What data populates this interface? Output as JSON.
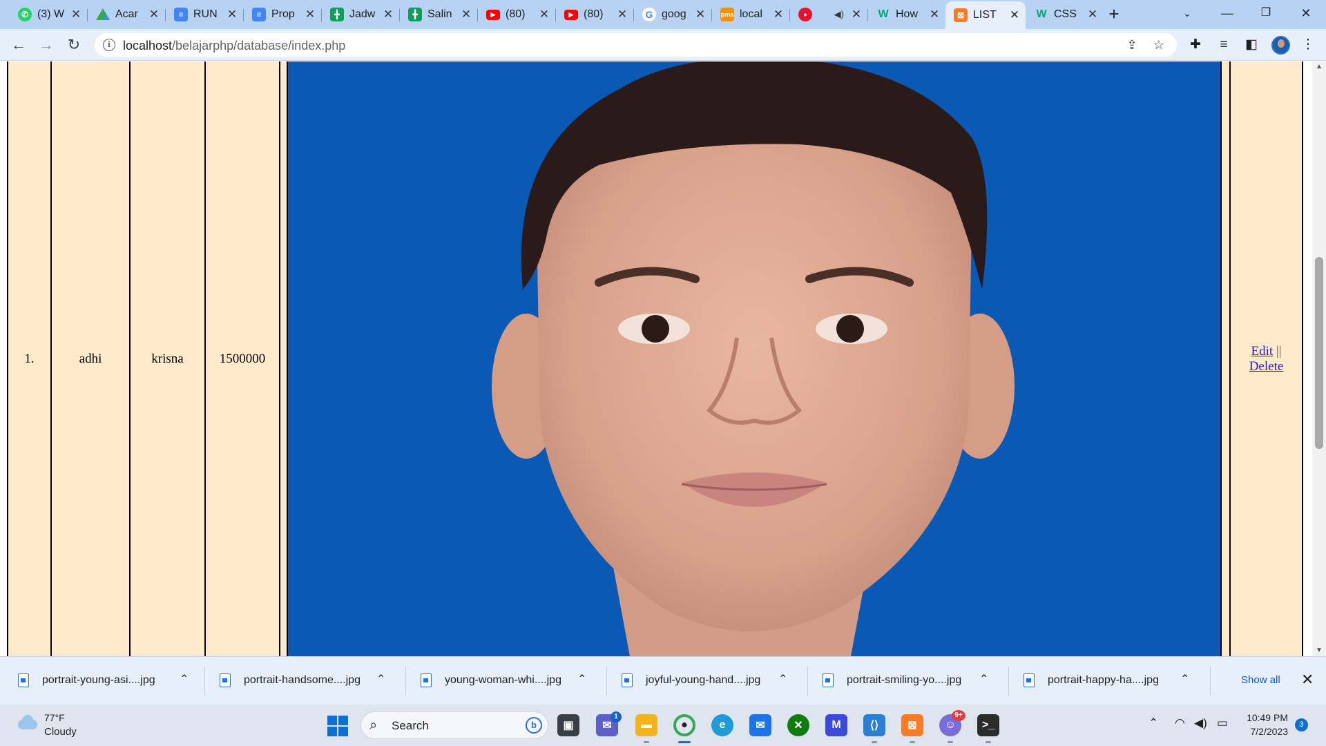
{
  "browser": {
    "tabs": [
      {
        "label": "(3) W",
        "icon": "whatsapp-icon",
        "color": "#25d366"
      },
      {
        "label": "Acar",
        "icon": "google-drive-icon",
        "color": "#1e8e3e"
      },
      {
        "label": "RUN",
        "icon": "google-docs-icon",
        "color": "#4285f4"
      },
      {
        "label": "Prop",
        "icon": "google-docs-icon",
        "color": "#4285f4"
      },
      {
        "label": "Jadw",
        "icon": "google-sheets-icon",
        "color": "#0f9d58"
      },
      {
        "label": "Salin",
        "icon": "google-sheets-icon",
        "color": "#0f9d58"
      },
      {
        "label": "(80)",
        "icon": "youtube-icon",
        "color": "#ff0000"
      },
      {
        "label": "(80)",
        "icon": "youtube-icon",
        "color": "#ff0000"
      },
      {
        "label": "goog",
        "icon": "google-icon",
        "color": "#ffffff"
      },
      {
        "label": "local",
        "icon": "phpmyadmin-icon",
        "color": "#f29111"
      },
      {
        "label": "",
        "icon": "recording-icon",
        "color": "#e8112d"
      },
      {
        "label": "How",
        "icon": "w3schools-icon",
        "color": "#04aa6d"
      },
      {
        "label": "LIST",
        "icon": "xampp-icon",
        "color": "#fb7a24"
      },
      {
        "label": "CSS",
        "icon": "w3schools-icon",
        "color": "#04aa6d"
      }
    ],
    "active_tab_index": 12,
    "new_tab_symbol": "+",
    "url_host": "localhost",
    "url_path": "/belajarphp/database/index.php"
  },
  "table_row": {
    "number": "1.",
    "first_name": "adhi",
    "last_name": "krisna",
    "amount": "1500000",
    "actions": {
      "edit": "Edit",
      "separator": "||",
      "delete": "Delete"
    },
    "photo_background": "#0a5ab5"
  },
  "downloads": {
    "files": [
      "portrait-young-asi....jpg",
      "portrait-handsome....jpg",
      "young-woman-whi....jpg",
      "joyful-young-hand....jpg",
      "portrait-smiling-yo....jpg",
      "portrait-happy-ha....jpg"
    ],
    "show_all": "Show all"
  },
  "taskbar": {
    "weather_temp": "77°F",
    "weather_condition": "Cloudy",
    "search_placeholder": "Search",
    "chat_badge": "1",
    "discord_badge": "9+",
    "time": "10:49 PM",
    "date": "7/2/2023",
    "notification_count": "3"
  },
  "colors": {
    "tabstrip": "#b7d2f2",
    "toolbar": "#e7effa",
    "table_cell": "#ffebcc",
    "link": "#2a1acd"
  }
}
